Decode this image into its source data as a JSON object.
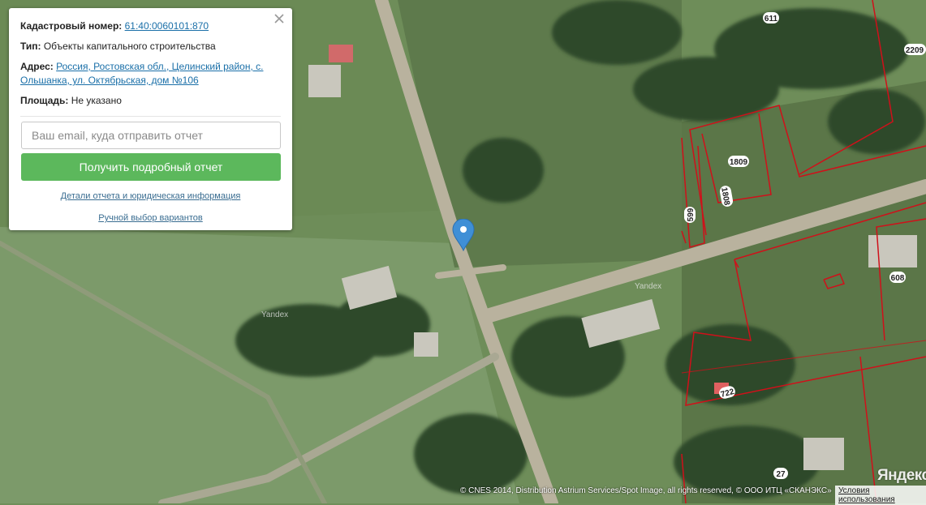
{
  "popup": {
    "cadastral_label": "Кадастровый номер:",
    "cadastral_value": "61:40:0060101:870",
    "type_label": "Тип:",
    "type_value": "Объекты капитального строительства",
    "address_label": "Адрес:",
    "address_value": "Россия, Ростовская обл., Целинский район, с. Ольшанка, ул. Октябрьская, дом №106",
    "area_label": "Площадь:",
    "area_value": "Не указано",
    "email_placeholder": "Ваш email, куда отправить отчет",
    "submit_label": "Получить подробный отчет",
    "details_link": "Детали отчета и юридическая информация",
    "manual_link": "Ручной выбор вариантов",
    "close_icon": "close-icon"
  },
  "map": {
    "parcel_labels": [
      "611",
      "2209",
      "1809",
      "1808",
      "599",
      "608",
      "722",
      "27"
    ],
    "watermarks": [
      "Yandex",
      "Yandex"
    ],
    "parcel_color": "#d0101a",
    "marker_color": "#3f8fd6",
    "marker_icon": "map-pin-icon"
  },
  "footer": {
    "copyright": "© CNES 2014, Distribution Astrium Services/Spot Image, all rights reserved, © ООО ИТЦ «СКАНЭКС»",
    "terms": "Условия использования",
    "logo": "Яндекс"
  }
}
